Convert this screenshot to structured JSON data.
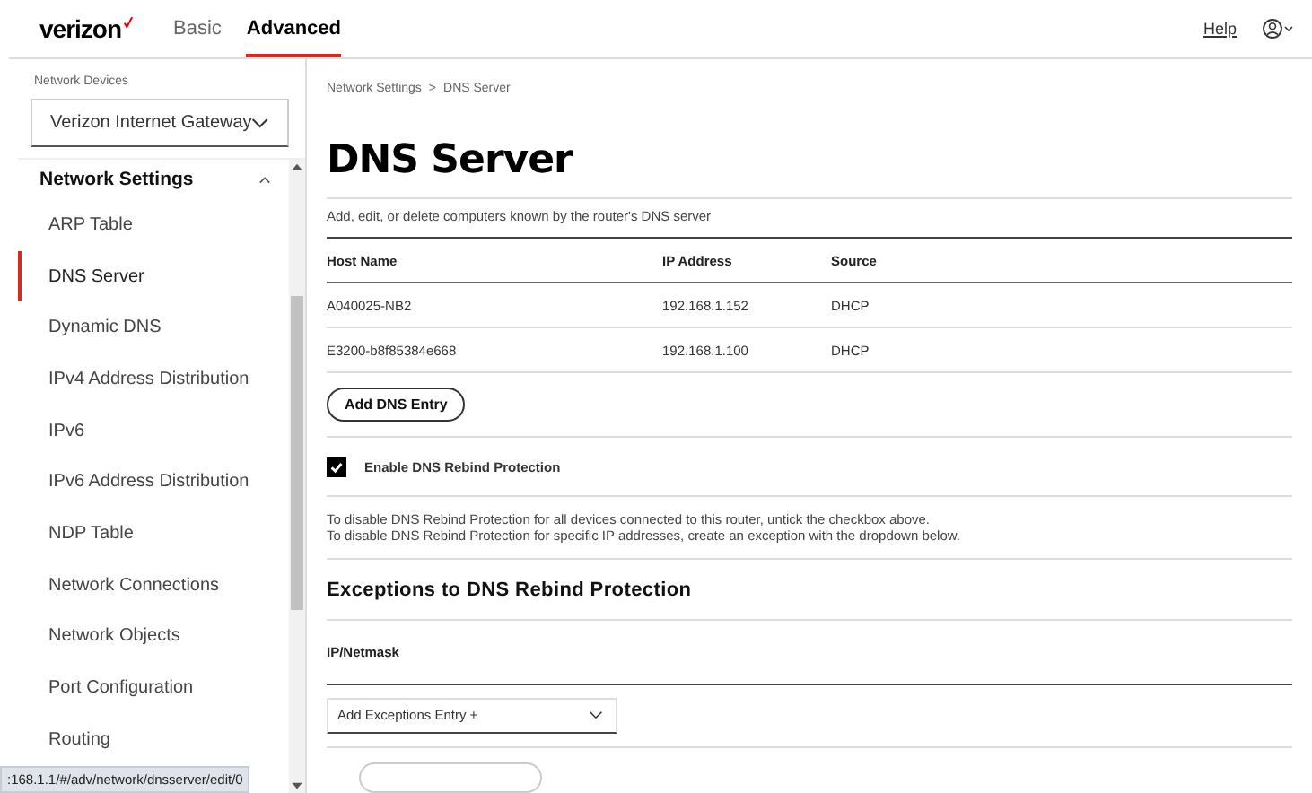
{
  "header": {
    "logo": "verizon",
    "tabs": [
      {
        "label": "Basic",
        "selected": false
      },
      {
        "label": "Advanced",
        "selected": true
      }
    ],
    "help_link": "Help"
  },
  "sidebar": {
    "device_label": "Network Devices",
    "device_select": "Verizon Internet Gateway",
    "section": {
      "title": "Network Settings",
      "expanded": true
    },
    "items": [
      {
        "label": "ARP Table",
        "selected": false
      },
      {
        "label": "DNS Server",
        "selected": true
      },
      {
        "label": "Dynamic DNS",
        "selected": false
      },
      {
        "label": "IPv4 Address Distribution",
        "selected": false
      },
      {
        "label": "IPv6",
        "selected": false
      },
      {
        "label": "IPv6 Address Distribution",
        "selected": false
      },
      {
        "label": "NDP Table",
        "selected": false
      },
      {
        "label": "Network Connections",
        "selected": false
      },
      {
        "label": "Network Objects",
        "selected": false
      },
      {
        "label": "Port Configuration",
        "selected": false
      },
      {
        "label": "Routing",
        "selected": false
      }
    ]
  },
  "breadcrumb": {
    "items": [
      "Network Settings",
      "DNS Server"
    ],
    "separator": ">"
  },
  "title": "DNS Server",
  "description": "Add, edit, or delete computers known by the router's DNS server",
  "table": {
    "columns": [
      "Host Name",
      "IP Address",
      "Source"
    ],
    "rows": [
      [
        "A040025-NB2",
        "192.168.1.152",
        "DHCP"
      ],
      [
        "E3200-b8f85384e668",
        "192.168.1.100",
        "DHCP"
      ]
    ]
  },
  "add_button": "Add DNS Entry",
  "rebind": {
    "label": "Enable DNS Rebind Protection",
    "checked": true
  },
  "notes": [
    "To disable DNS Rebind Protection for all devices connected to this router, untick the checkbox above.",
    "To disable DNS Rebind Protection for specific IP addresses, create an exception with the dropdown below."
  ],
  "exceptions": {
    "heading": "Exceptions to DNS Rebind Protection",
    "column": "IP/Netmask",
    "select": "Add Exceptions Entry +"
  },
  "status_bar": ":168.1.1/#/adv/network/dnsserver/edit/0"
}
